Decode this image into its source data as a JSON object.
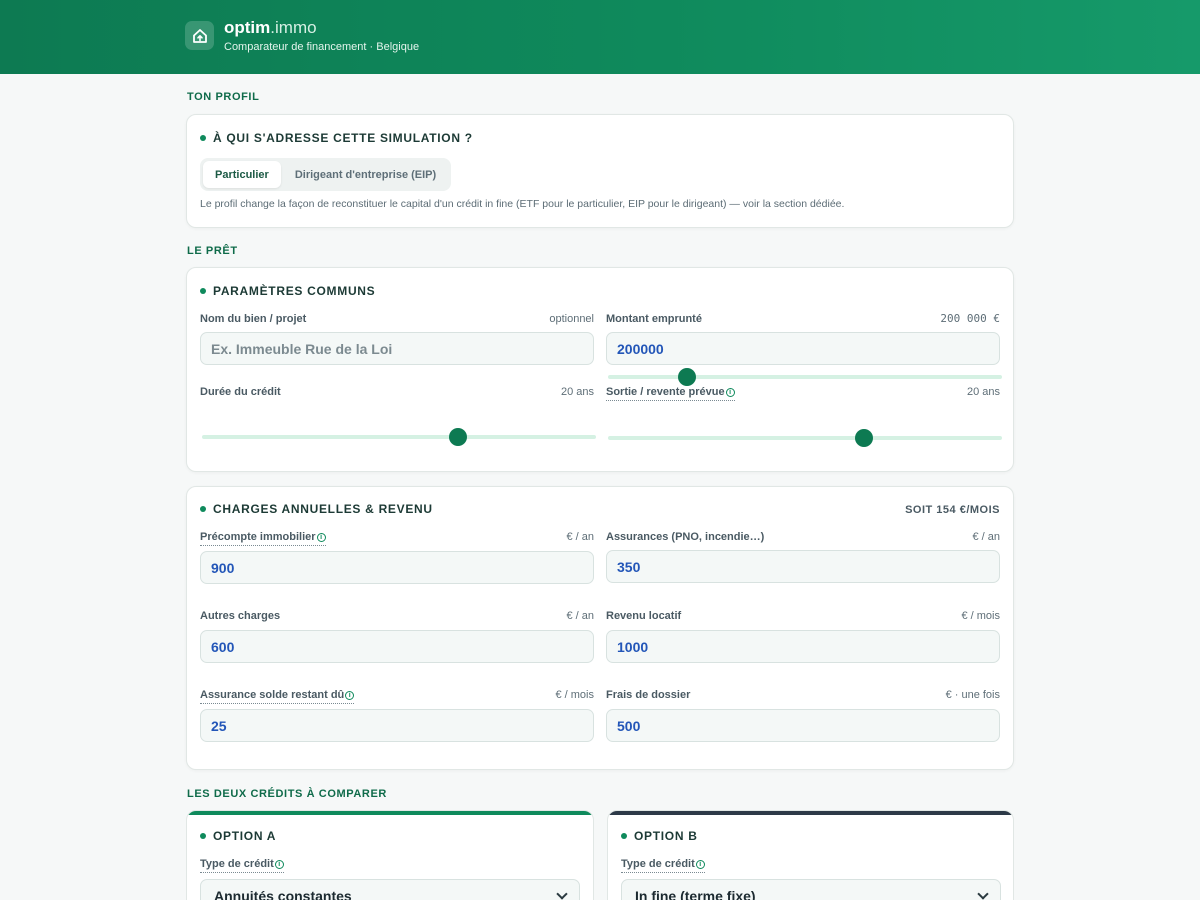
{
  "app": {
    "brand": "optim",
    "brand_suffix": ".immo",
    "tagline": "Comparateur de financement · Belgique"
  },
  "colors": {
    "header": "#0f8a5c",
    "accent": "#0d7a52",
    "value_text": "#2356b8",
    "option_b_bar": "#2d3a48"
  },
  "profile": {
    "heading": "Ton profil",
    "card_title": "À QUI S'ADRESSE CETTE SIMULATION ?",
    "options": [
      "Particulier",
      "Dirigeant d'entreprise (EIP)"
    ],
    "selected": "Particulier",
    "help": "Le profil change la façon de reconstituer le capital d'un crédit in fine (ETF pour le particulier, EIP pour le dirigeant) — voir la section dédiée."
  },
  "loan": {
    "heading": "Le prêt",
    "card_title": "PARAMÈTRES COMMUNS",
    "name_label": "Nom du bien / projet",
    "name_hint": "optionnel",
    "name_placeholder": "Ex. Immeuble Rue de la Loi",
    "amount_label": "Montant emprunté",
    "amount_display": "200 000 €",
    "amount_value": "200000",
    "amount_slider_fraction": 0.2,
    "duration_label": "Durée du crédit",
    "duration_value": "20 ans",
    "duration_slider_fraction": 0.65,
    "exit_label": "Sortie / revente prévue",
    "exit_value": "20 ans",
    "exit_slider_fraction": 0.65
  },
  "charges": {
    "card_title": "CHARGES ANNUELLES & REVENU",
    "total": "SOIT 154 €/MOIS",
    "fields": {
      "tax_label": "Précompte immobilier",
      "tax_unit": "€ / an",
      "tax_value": "900",
      "insurance_label": "Assurances (PNO, incendie…)",
      "insurance_unit": "€ / an",
      "insurance_value": "350",
      "other_label": "Autres charges",
      "other_unit": "€ / an",
      "other_value": "600",
      "rent_label": "Revenu locatif",
      "rent_unit": "€ / mois",
      "rent_value": "1000",
      "ssrd_label": "Assurance solde restant dû",
      "ssrd_unit": "€ / mois",
      "ssrd_value": "25",
      "fees_label": "Frais de dossier",
      "fees_unit": "€ · une fois",
      "fees_value": "500"
    }
  },
  "compare": {
    "heading": "Les deux crédits à comparer",
    "option_a": {
      "title": "OPTION A",
      "type_label": "Type de crédit",
      "type_value": "Annuités constantes"
    },
    "option_b": {
      "title": "OPTION B",
      "type_label": "Type de crédit",
      "type_value": "In fine (terme fixe)"
    }
  }
}
